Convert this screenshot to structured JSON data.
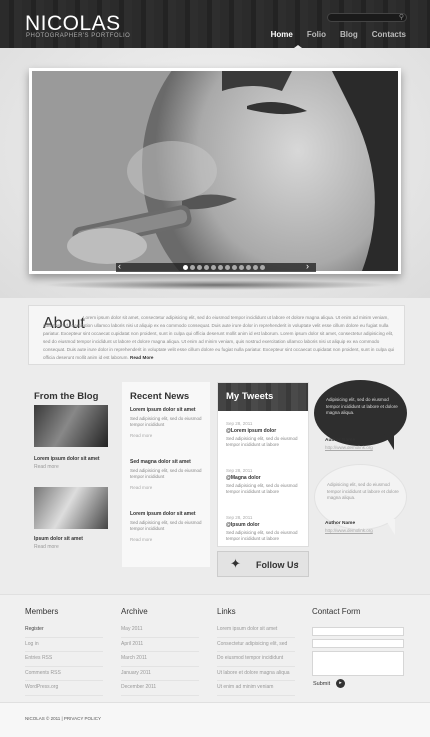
{
  "header": {
    "logo": "NICOLAS",
    "tagline": "PHOTOGRAPHER'S PORTFOLIO",
    "nav": [
      "Home",
      "Folio",
      "Blog",
      "Contacts"
    ],
    "active_nav": "Home",
    "search_icon": "search-icon"
  },
  "slider": {
    "prev_icon": "‹",
    "next_icon": "›",
    "dot_count": 12,
    "active_dot": 1
  },
  "about": {
    "title": "About",
    "text": "Lorem ipsum dolor sit amet, consectetur adipisicing elit, sed do eiusmod tempor incididunt ut labore et dolore magna aliqua. Ut enim ad minim veniam, quis nostrud exercitation ullamco laboris nisi ut aliquip ex ea commodo consequat. Duis aute irure dolor in reprehenderit in voluptate velit esse cillum dolore eu fugiat nulla pariatur. Excepteur sint occaecat cupidatat non proident, sunt in culpa qui officia deserunt mollit anim id est laborum. Lorem ipsum dolor sit amet, consectetur adipisicing elit, sed do eiusmod tempor incididunt ut labore et dolore magna aliqua. Ut enim ad minim veniam, quis nostrud exercitation ullamco laboris nisi ut aliquip ex ea commodo consequat. Duis aute irure dolor in reprehenderit in voluptate velit esse cillum dolore eu fugiat nulla pariatur. Excepteur sint occaecat cupidatat non proident, sunt in culpa qui officia deserunt mollit anim id est laborum.",
    "more": "Read More"
  },
  "blog": {
    "title": "From the Blog",
    "posts": [
      {
        "caption": "Lorem ipsum dolor sit amet",
        "more": "Read more"
      },
      {
        "caption": "Ipsum dolor sit amet",
        "more": "Read more"
      }
    ]
  },
  "news": {
    "title": "Recent News",
    "items": [
      {
        "head": "Lorem ipsum dolor sit amet",
        "body": "Sed adipisicing elit, sed do eiusmod tempor incididunt",
        "more": "Read more"
      },
      {
        "head": "Sed magna dolor sit amet",
        "body": "Sed adipisicing elit, sed do eiusmod tempor incididunt",
        "more": "Read more"
      },
      {
        "head": "Lorem ipsum dolor sit amet",
        "body": "Sed adipisicing elit, sed do eiusmod tempor incididunt",
        "more": "Read more"
      }
    ]
  },
  "tweets": {
    "title": "My Tweets",
    "items": [
      {
        "date": "Sep 28, 2011",
        "user": "@Lorem ipsum dolor",
        "text": "Sed adipisicing elit, sed do eiusmod tempor incididunt ut labore"
      },
      {
        "date": "Sep 28, 2011",
        "user": "@Magna dolor",
        "text": "Sed adipisicing elit, sed do eiusmod tempor incididunt ut labore"
      },
      {
        "date": "Sep 28, 2011",
        "user": "@Ipsum dolor",
        "text": "Sed adipisicing elit, sed do eiusmod tempor incididunt ut labore"
      }
    ],
    "follow": "Follow Us",
    "follow_icon": "twitter-bird-icon"
  },
  "testimonials": [
    {
      "text": "Adipisicing elit, sed do eiusmod tempor incididunt ut labore et dolore magna aliqua.",
      "author": "Author Name",
      "url": "http://www.demolink.org"
    },
    {
      "text": "Adipisicing elit, sed do eiusmod tempor incididunt ut labore et dolore magna aliqua.",
      "author": "Author Name",
      "url": "http://www.demolink.org"
    }
  ],
  "footer": {
    "members": {
      "title": "Members",
      "items": [
        "Register",
        "Log in",
        "Entries RSS",
        "Comments RSS",
        "WordPress.org"
      ]
    },
    "archive": {
      "title": "Archive",
      "items": [
        "May 2011",
        "April 2011",
        "March 2011",
        "January 2011",
        "December 2011"
      ]
    },
    "links": {
      "title": "Links",
      "items": [
        "Lorem ipsum dolor sit amet",
        "Consectetur adipisicing elit, sed",
        "Do eiusmod tempor incididunt",
        "Ut labore et dolore magna aliqua",
        "Ut enim ad minim veniam"
      ]
    },
    "contact": {
      "title": "Contact Form",
      "submit": "Submit"
    },
    "copyright": "NICOLAS © 2011 | PRIVACY POLICY"
  }
}
